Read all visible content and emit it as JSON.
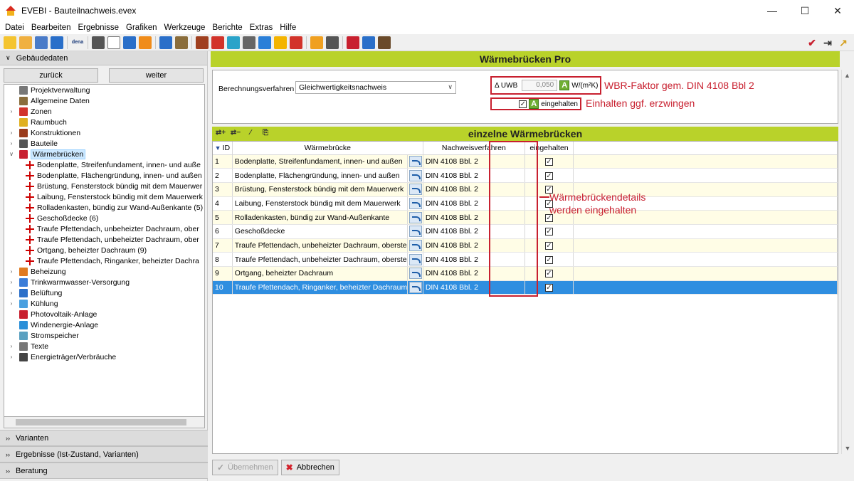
{
  "window": {
    "title": "EVEBI - Bauteilnachweis.evex"
  },
  "menu": [
    "Datei",
    "Bearbeiten",
    "Ergebnisse",
    "Grafiken",
    "Werkzeuge",
    "Berichte",
    "Extras",
    "Hilfe"
  ],
  "toolbar": {
    "icons": [
      "new-file-icon",
      "open-folder-icon",
      "copy-icon",
      "export-arrow-icon",
      "dena-icon",
      "wand-icon",
      "page-icon",
      "page-split-icon",
      "orange-arrow-icon",
      "blue-arrow-icon",
      "hierarchy-icon",
      "list-icon",
      "red-window-icon",
      "grid-icon",
      "magnify-icon",
      "fan-icon",
      "sun-icon",
      "lightning-icon",
      "euro-icon",
      "report-icon",
      "chart-icon",
      "help-icon",
      "device-icon"
    ],
    "dena_label": "dena",
    "right_icons": [
      "checkmark-icon",
      "exit-icon",
      "graph-icon"
    ]
  },
  "left": {
    "section_title": "Gebäudedaten",
    "back_label": "zurück",
    "forward_label": "weiter",
    "tree": [
      {
        "label": "Projektverwaltung",
        "icon": "gear-icon",
        "color": "#777777",
        "expandable": false
      },
      {
        "label": "Allgemeine Daten",
        "icon": "house-icon",
        "color": "#8a6d3b",
        "expandable": false
      },
      {
        "label": "Zonen",
        "icon": "zone-icon",
        "color": "#d2332a",
        "expandable": true
      },
      {
        "label": "Raumbuch",
        "icon": "book-icon",
        "color": "#e0b020",
        "expandable": false
      },
      {
        "label": "Konstruktionen",
        "icon": "construction-icon",
        "color": "#9a3b1b",
        "expandable": true
      },
      {
        "label": "Bauteile",
        "icon": "building-part-icon",
        "color": "#555555",
        "expandable": true
      },
      {
        "label": "Wärmebrücken",
        "icon": "thermal-bridge-icon",
        "color": "#c8202f",
        "expandable": true,
        "expanded": true,
        "selected": true
      },
      {
        "label": "Bodenplatte, Streifenfundament, innen- und auße",
        "child": true
      },
      {
        "label": "Bodenplatte, Flächengründung, innen- und außen",
        "child": true
      },
      {
        "label": "Brüstung, Fensterstock bündig mit dem Mauerwer",
        "child": true
      },
      {
        "label": "Laibung, Fensterstock bündig mit dem Mauerwerk",
        "child": true
      },
      {
        "label": "Rolladenkasten, bündig zur Wand-Außenkante (5)",
        "child": true
      },
      {
        "label": "Geschoßdecke (6)",
        "child": true
      },
      {
        "label": "Traufe Pfettendach, unbeheizter Dachraum, ober",
        "child": true
      },
      {
        "label": "Traufe Pfettendach, unbeheizter Dachraum, ober",
        "child": true
      },
      {
        "label": "Ortgang, beheizter Dachraum (9)",
        "child": true
      },
      {
        "label": "Traufe Pfettendach, Ringanker, beheizter Dachra",
        "child": true
      },
      {
        "label": "Beheizung",
        "icon": "heating-icon",
        "color": "#e07a20",
        "expandable": true
      },
      {
        "label": "Trinkwarmwasser-Versorgung",
        "icon": "water-drop-icon",
        "color": "#3b7dd8",
        "expandable": true
      },
      {
        "label": "Belüftung",
        "icon": "fan-icon",
        "color": "#2a6fc9",
        "expandable": true
      },
      {
        "label": "Kühlung",
        "icon": "snowflake-icon",
        "color": "#4aa0e0",
        "expandable": true
      },
      {
        "label": "Photovoltaik-Anlage",
        "icon": "pv-icon",
        "color": "#c8202f",
        "expandable": false
      },
      {
        "label": "Windenergie-Anlage",
        "icon": "wind-icon",
        "color": "#2a8fd8",
        "expandable": false
      },
      {
        "label": "Stromspeicher",
        "icon": "battery-icon",
        "color": "#5aa0c0",
        "expandable": false
      },
      {
        "label": "Texte",
        "icon": "text-icon",
        "color": "#777777",
        "expandable": true
      },
      {
        "label": "Energieträger/Verbräuche",
        "icon": "energy-icon",
        "color": "#444444",
        "expandable": true
      }
    ],
    "lower_sections": [
      "Varianten",
      "Ergebnisse (Ist-Zustand, Varianten)",
      "Beratung"
    ]
  },
  "main": {
    "banner": "Wärmebrücken Pro",
    "method_label": "Berechnungsverfahren",
    "method_value": "Gleichwertigkeitsnachweis",
    "uwb_label": "Δ UWB",
    "uwb_value": "0,050",
    "a_badge": "A",
    "uwb_unit": "W/(m²K)",
    "compliance_label": "eingehalten",
    "annotation_factor": "WBR-Faktor gem. DIN 4108 Bbl 2",
    "annotation_force": "Einhalten ggf. erzwingen",
    "annotation_details_line1": "Wärmebrückendetails",
    "annotation_details_line2": "werden eingehalten",
    "grid_title": "einzelne Wärmebrücken",
    "grid_icons": [
      "add-row-icon",
      "remove-row-icon",
      "wand-icon",
      "paste-icon"
    ],
    "columns": [
      "ID",
      "Wärmebrücke",
      "Nachweisverfahren",
      "eingehalten"
    ],
    "rows": [
      {
        "id": "1",
        "name": "Bodenplatte, Streifenfundament, innen- und außen",
        "verfahren": "DIN 4108 Bbl. 2",
        "checked": true
      },
      {
        "id": "2",
        "name": "Bodenplatte, Flächengründung, innen- und außen",
        "verfahren": "DIN 4108 Bbl. 2",
        "checked": true
      },
      {
        "id": "3",
        "name": "Brüstung, Fensterstock bündig mit dem Mauerwerk",
        "verfahren": "DIN 4108 Bbl. 2",
        "checked": true
      },
      {
        "id": "4",
        "name": "Laibung, Fensterstock bündig mit dem Mauerwerk",
        "verfahren": "DIN 4108 Bbl. 2",
        "checked": true
      },
      {
        "id": "5",
        "name": "Rolladenkasten, bündig zur Wand-Außenkante",
        "verfahren": "DIN 4108 Bbl. 2",
        "checked": true
      },
      {
        "id": "6",
        "name": "Geschoßdecke",
        "verfahren": "DIN 4108 Bbl. 2",
        "checked": true
      },
      {
        "id": "7",
        "name": "Traufe Pfettendach, unbeheizter Dachraum, oberste",
        "verfahren": "DIN 4108 Bbl. 2",
        "checked": true
      },
      {
        "id": "8",
        "name": "Traufe Pfettendach, unbeheizter Dachraum, oberste",
        "verfahren": "DIN 4108 Bbl. 2",
        "checked": true
      },
      {
        "id": "9",
        "name": "Ortgang, beheizter Dachraum",
        "verfahren": "DIN 4108 Bbl. 2",
        "checked": true
      },
      {
        "id": "10",
        "name": "Traufe Pfettendach, Ringanker, beheizter Dachraum",
        "verfahren": "DIN 4108 Bbl. 2",
        "checked": true,
        "selected": true
      }
    ],
    "apply_label": "Übernehmen",
    "cancel_label": "Abbrechen"
  },
  "colors": {
    "accent_green": "#b9d22a",
    "annotation_red": "#c8202f",
    "selection_blue": "#2f8ee0"
  }
}
